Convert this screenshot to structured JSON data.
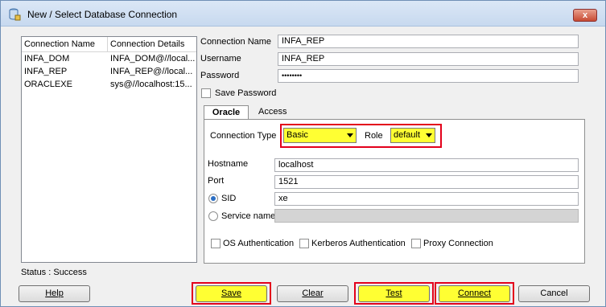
{
  "window": {
    "title": "New / Select Database Connection",
    "close_label": "x"
  },
  "connections": {
    "headers": [
      "Connection Name",
      "Connection Details"
    ],
    "rows": [
      {
        "name": "INFA_DOM",
        "details": "INFA_DOM@//local..."
      },
      {
        "name": "INFA_REP",
        "details": "INFA_REP@//local..."
      },
      {
        "name": "ORACLEXE",
        "details": "sys@//localhost:15..."
      }
    ]
  },
  "status": "Status : Success",
  "form": {
    "connection_name_label": "Connection Name",
    "connection_name_value": "INFA_REP",
    "username_label": "Username",
    "username_value": "INFA_REP",
    "password_label": "Password",
    "password_value": "••••••••",
    "save_password_label": "Save Password"
  },
  "tabs": {
    "oracle": "Oracle",
    "access": "Access"
  },
  "oracle": {
    "connection_type_label": "Connection Type",
    "connection_type_value": "Basic",
    "role_label": "Role",
    "role_value": "default",
    "hostname_label": "Hostname",
    "hostname_value": "localhost",
    "port_label": "Port",
    "port_value": "1521",
    "sid_label": "SID",
    "sid_value": "xe",
    "service_name_label": "Service name",
    "os_auth_label": "OS Authentication",
    "kerberos_label": "Kerberos Authentication",
    "proxy_label": "Proxy Connection"
  },
  "buttons": {
    "help": "Help",
    "save": "Save",
    "clear": "Clear",
    "test": "Test",
    "connect": "Connect",
    "cancel": "Cancel"
  },
  "colors": {
    "highlight": "#ffff33",
    "annotation_red": "#e3001b"
  },
  "icons": {
    "title": "database-icon",
    "close": "close-icon"
  }
}
